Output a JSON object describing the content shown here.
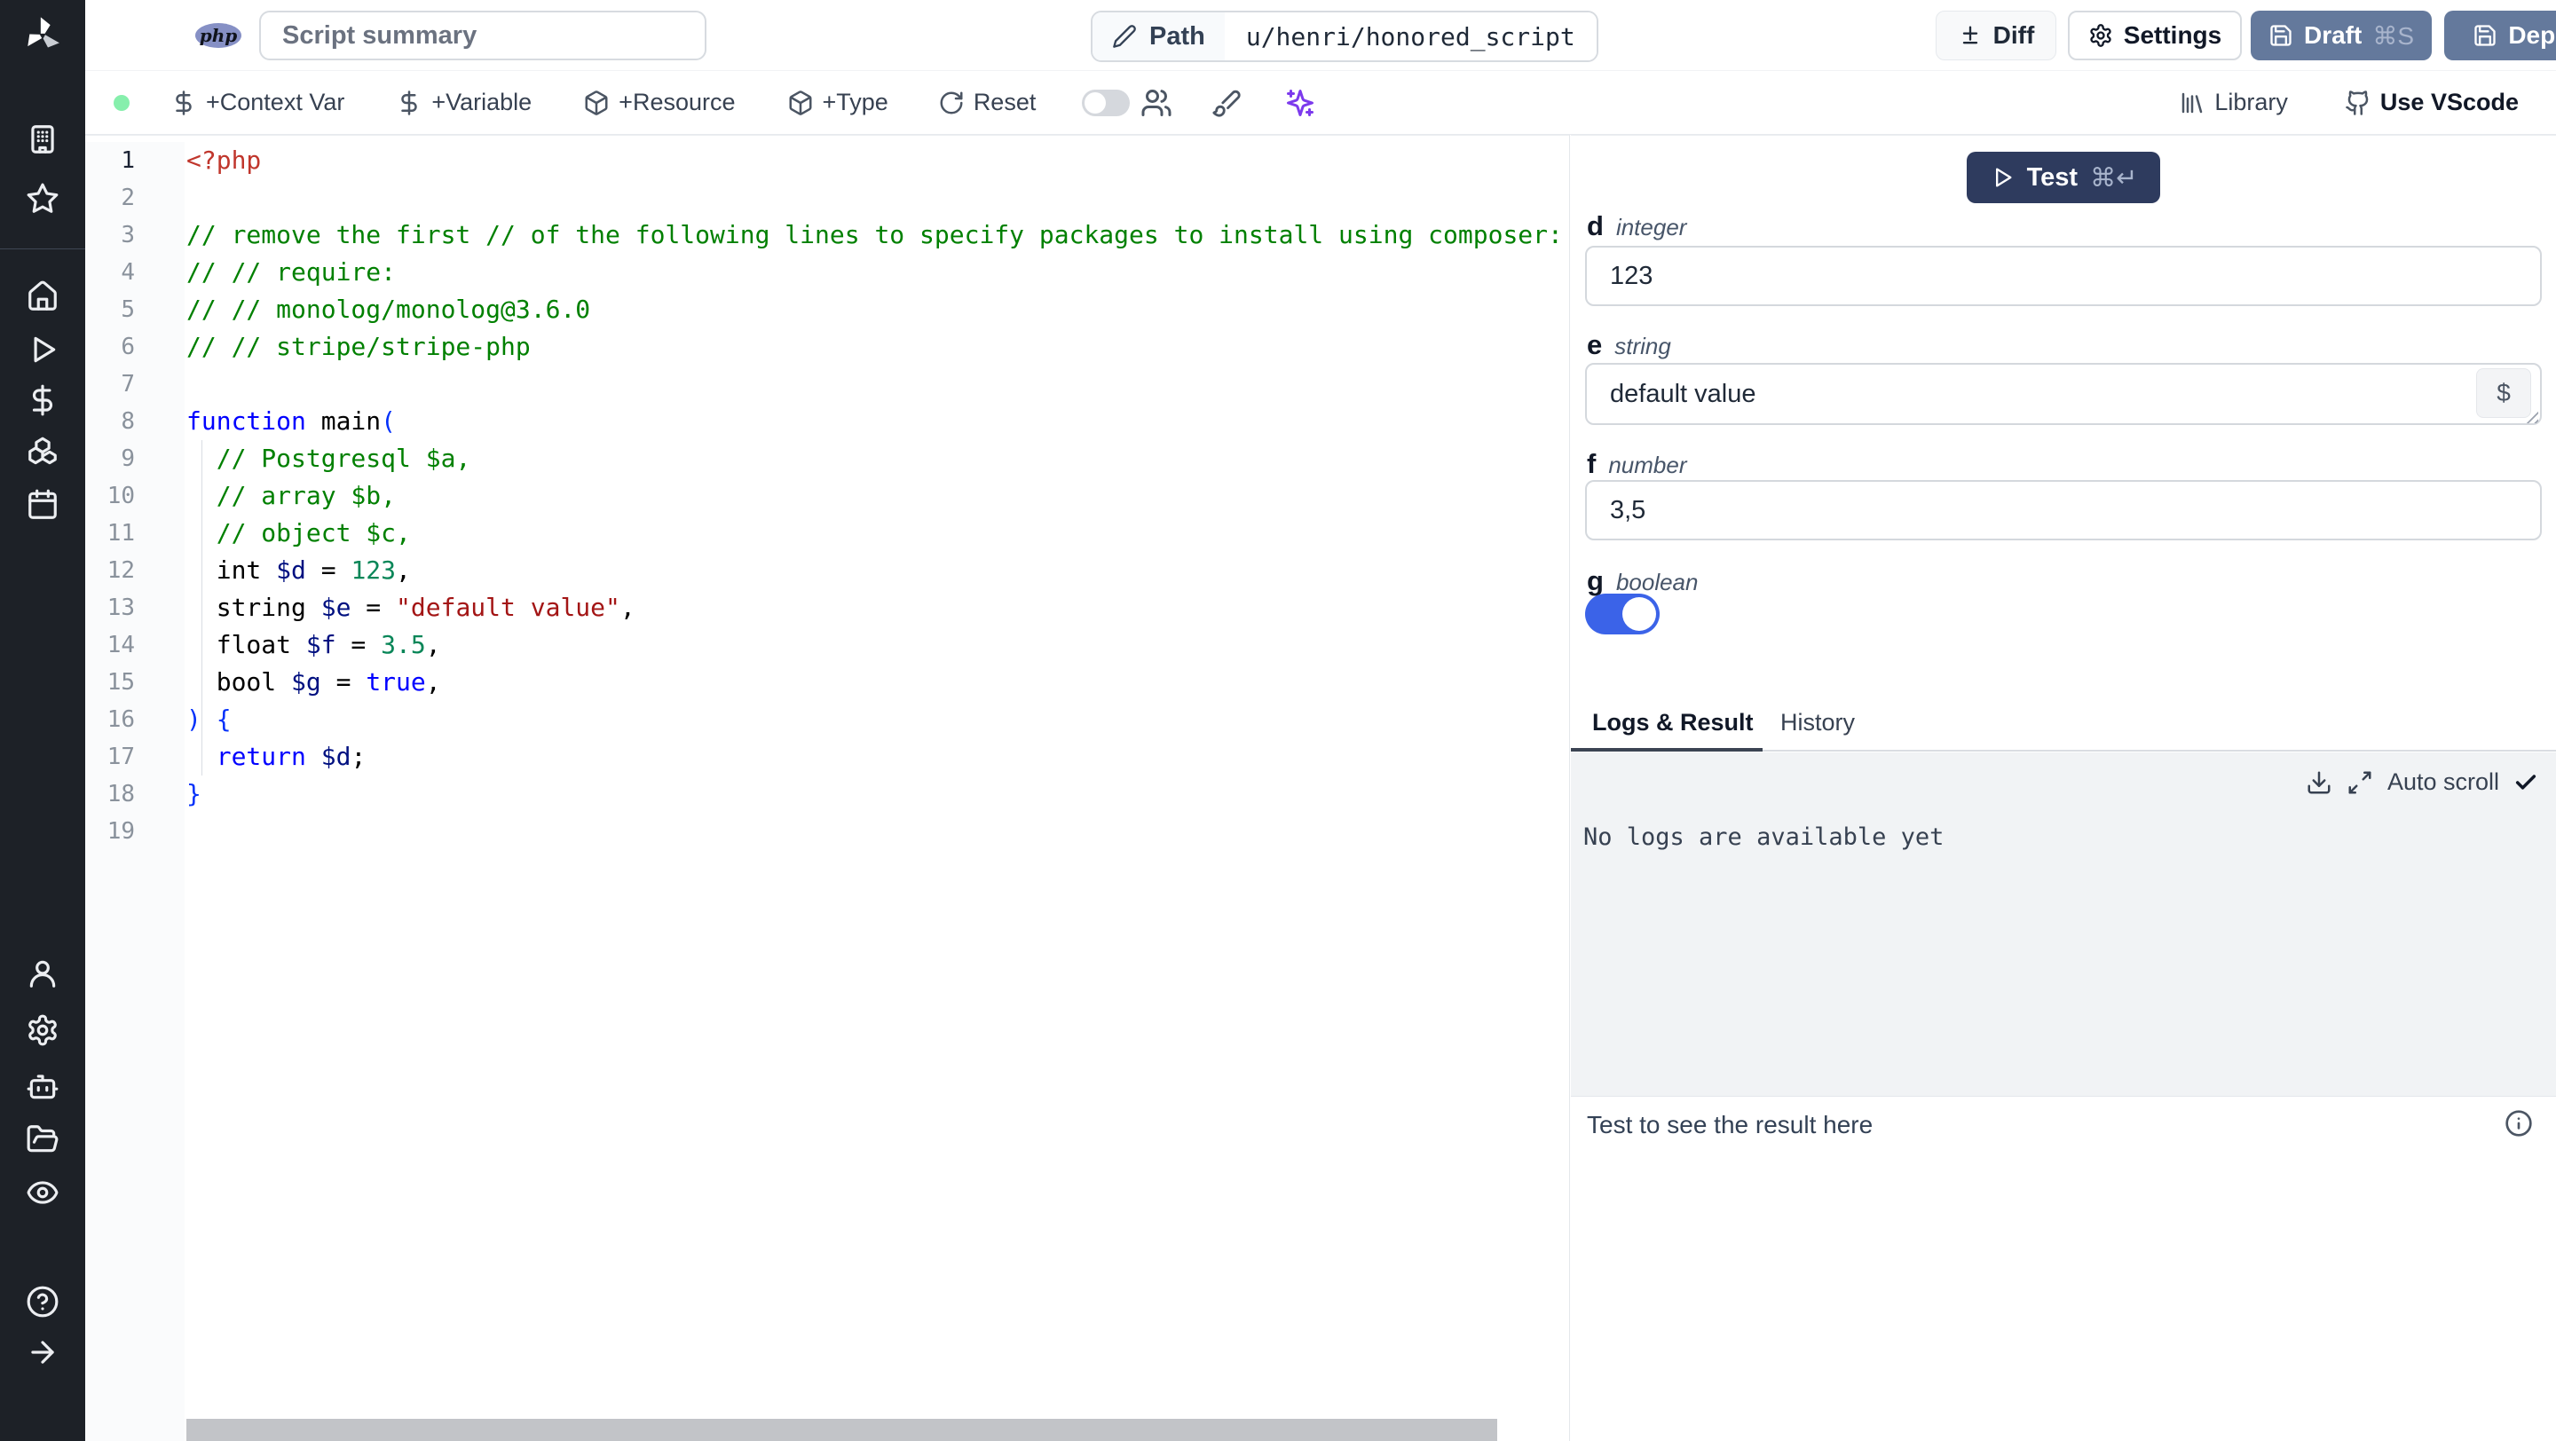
{
  "topbar": {
    "language_badge": "php",
    "summary_value": "Script summary",
    "path_label": "Path",
    "path_value": "u/henri/honored_script",
    "diff_label": "Diff",
    "settings_label": "Settings",
    "draft_label": "Draft",
    "draft_shortcut": "⌘S",
    "deploy_label": "Deploy"
  },
  "toolbar": {
    "add_context_var": "+Context Var",
    "add_variable": "+Variable",
    "add_resource": "+Resource",
    "add_type": "+Type",
    "reset_label": "Reset",
    "library_label": "Library",
    "use_vscode_label": "Use VScode"
  },
  "editor": {
    "active_line": 1,
    "lines": [
      [
        {
          "t": "<?php",
          "c": "meta"
        }
      ],
      [],
      [
        {
          "t": "// remove the first // of the following lines to specify packages to install using composer:",
          "c": "com"
        }
      ],
      [
        {
          "t": "// // require:",
          "c": "com"
        }
      ],
      [
        {
          "t": "// // monolog/monolog@3.6.0",
          "c": "com"
        }
      ],
      [
        {
          "t": "// // stripe/stripe-php",
          "c": "com"
        }
      ],
      [],
      [
        {
          "t": "function",
          "c": "kw"
        },
        {
          "t": " main",
          "c": "pl"
        },
        {
          "t": "(",
          "c": "br"
        }
      ],
      [
        {
          "t": "  ",
          "c": "pl"
        },
        {
          "t": "// Postgresql $a,",
          "c": "com"
        }
      ],
      [
        {
          "t": "  ",
          "c": "pl"
        },
        {
          "t": "// array $b,",
          "c": "com"
        }
      ],
      [
        {
          "t": "  ",
          "c": "pl"
        },
        {
          "t": "// object $c,",
          "c": "com"
        }
      ],
      [
        {
          "t": "  int ",
          "c": "pl"
        },
        {
          "t": "$d",
          "c": "var"
        },
        {
          "t": " = ",
          "c": "pl"
        },
        {
          "t": "123",
          "c": "num"
        },
        {
          "t": ",",
          "c": "pl"
        }
      ],
      [
        {
          "t": "  string ",
          "c": "pl"
        },
        {
          "t": "$e",
          "c": "var"
        },
        {
          "t": " = ",
          "c": "pl"
        },
        {
          "t": "\"default value\"",
          "c": "str"
        },
        {
          "t": ",",
          "c": "pl"
        }
      ],
      [
        {
          "t": "  float ",
          "c": "pl"
        },
        {
          "t": "$f",
          "c": "var"
        },
        {
          "t": " = ",
          "c": "pl"
        },
        {
          "t": "3.5",
          "c": "num"
        },
        {
          "t": ",",
          "c": "pl"
        }
      ],
      [
        {
          "t": "  bool ",
          "c": "pl"
        },
        {
          "t": "$g",
          "c": "var"
        },
        {
          "t": " = ",
          "c": "pl"
        },
        {
          "t": "true",
          "c": "kw"
        },
        {
          "t": ",",
          "c": "pl"
        }
      ],
      [
        {
          "t": ") {",
          "c": "br"
        }
      ],
      [
        {
          "t": "  ",
          "c": "pl"
        },
        {
          "t": "return",
          "c": "kw"
        },
        {
          "t": " ",
          "c": "pl"
        },
        {
          "t": "$d",
          "c": "var"
        },
        {
          "t": ";",
          "c": "pl"
        }
      ],
      [
        {
          "t": "}",
          "c": "br"
        }
      ],
      []
    ]
  },
  "runner": {
    "test_label": "Test",
    "test_shortcut": "⌘↵",
    "string_picker_label": "$",
    "fields": [
      {
        "name": "d",
        "type": "integer",
        "value": "123"
      },
      {
        "name": "e",
        "type": "string",
        "value": "default value"
      },
      {
        "name": "f",
        "type": "number",
        "value": "3,5"
      },
      {
        "name": "g",
        "type": "boolean",
        "value": "true"
      }
    ]
  },
  "results": {
    "tab_logs": "Logs & Result",
    "tab_history": "History",
    "auto_scroll_label": "Auto scroll",
    "no_logs_text": "No logs are available yet",
    "result_placeholder": "Test to see the result here"
  },
  "colors": {
    "sidebar": "#1d2127",
    "accent": "#64799c",
    "test-button": "#2e3b5e",
    "toggle-on": "#3b63e8",
    "status-green": "#86efac",
    "sparkles": "#7c3aed",
    "php-badge": "#8690c5"
  }
}
